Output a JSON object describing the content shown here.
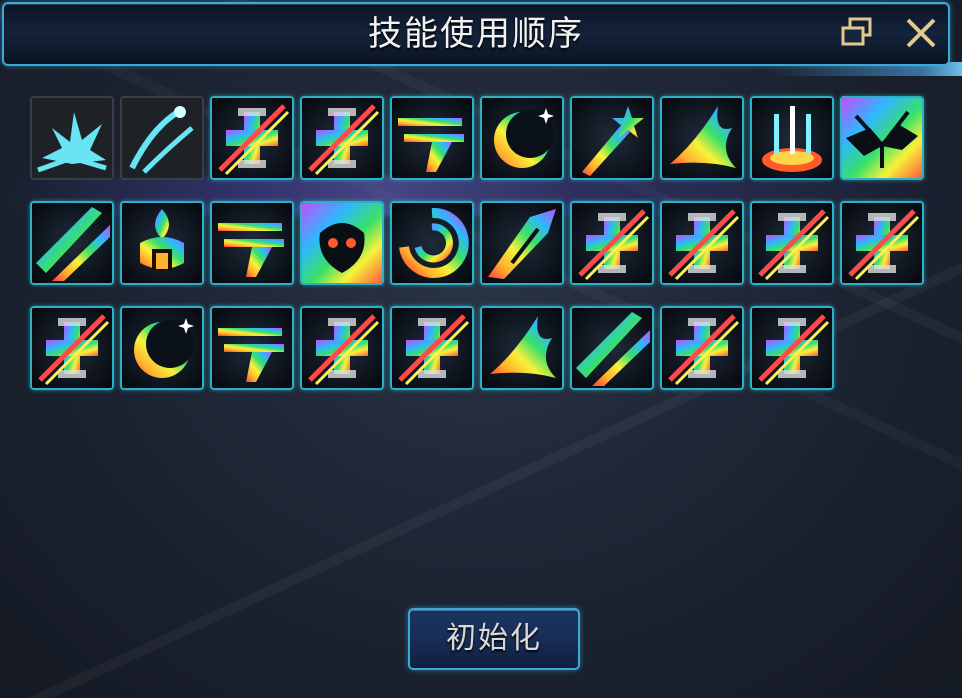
{
  "window": {
    "title": "技能使用顺序",
    "restore_icon": "restore-window-icon",
    "close_icon": "close-icon"
  },
  "skills": {
    "rows": [
      [
        "skill-basic-burst-icon",
        "skill-basic-slash-icon",
        "skill-locked-icon",
        "skill-locked-icon",
        "skill-dash-slash-icon",
        "skill-crescent-moon-icon",
        "skill-star-strike-icon",
        "skill-fire-burst-icon",
        "skill-sword-rain-icon",
        "skill-ground-shatter-icon"
      ],
      [
        "skill-diagonal-slash-icon",
        "skill-flame-totem-icon",
        "skill-dash-slash-icon",
        "skill-demon-mask-icon",
        "skill-vortex-icon",
        "skill-rising-strike-icon",
        "skill-locked-icon",
        "skill-locked-icon",
        "skill-locked-icon",
        "skill-locked-icon"
      ],
      [
        "skill-locked-icon",
        "skill-crescent-moon-icon",
        "skill-dash-slash-icon",
        "skill-locked-icon",
        "skill-locked-icon",
        "skill-fire-burst-icon",
        "skill-diagonal-slash-icon",
        "skill-locked-icon",
        "skill-locked-icon"
      ]
    ]
  },
  "footer": {
    "reset_label": "初始化"
  },
  "colors": {
    "frame_accent": "#3aa9d8",
    "slot_border": "#2bb0c6",
    "title_text": "#f2f2f2",
    "close_x": "#e2c98d"
  }
}
